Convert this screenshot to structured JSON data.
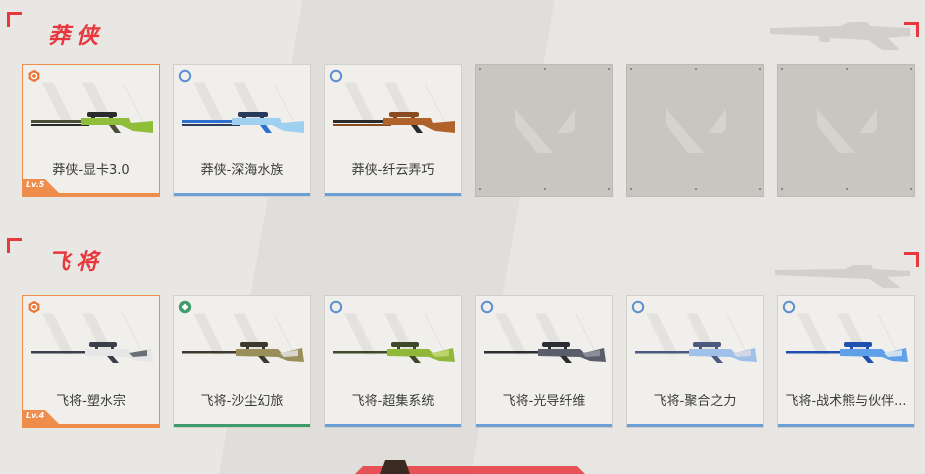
{
  "sections": [
    {
      "title": "莽侠",
      "cards": [
        {
          "label": "莽侠-显卡3.0",
          "rarity": "orange",
          "badge": "premium-hex-icon",
          "level": "Lv.5",
          "gun_colors": [
            "#4a4f3a",
            "#8fbf3a",
            "#2b2b2b"
          ]
        },
        {
          "label": "莽侠-深海水族",
          "rarity": "blue",
          "badge": "ring-icon",
          "gun_colors": [
            "#2f6fcf",
            "#9fd0f0",
            "#2a3a5a"
          ]
        },
        {
          "label": "莽侠-纤云弄巧",
          "rarity": "blue",
          "badge": "ring-icon",
          "gun_colors": [
            "#2b2b2b",
            "#b0622b",
            "#8a4a22"
          ]
        }
      ],
      "empty_slots": 3
    },
    {
      "title": "飞将",
      "cards": [
        {
          "label": "飞将-塑水宗",
          "rarity": "orange",
          "badge": "premium-hex-icon",
          "level": "Lv.4",
          "gun_colors": [
            "#3b3f4a",
            "#e6e6e6",
            "#6a6f7a"
          ]
        },
        {
          "label": "飞将-沙尘幻旅",
          "rarity": "green",
          "badge": "diamond-icon",
          "gun_colors": [
            "#3a3a2f",
            "#9a8f5a",
            "#d8d8d0"
          ]
        },
        {
          "label": "飞将-超集系统",
          "rarity": "blue",
          "badge": "ring-icon",
          "gun_colors": [
            "#3d4a2a",
            "#8fb83a",
            "#bcd46a"
          ]
        },
        {
          "label": "飞将-光导纤维",
          "rarity": "blue",
          "badge": "ring-icon",
          "gun_colors": [
            "#2b2d33",
            "#5a5e6a",
            "#8a8e98"
          ]
        },
        {
          "label": "飞将-聚合之力",
          "rarity": "blue",
          "badge": "ring-icon",
          "gun_colors": [
            "#4a5a80",
            "#9fc0e8",
            "#d0d8e8"
          ]
        },
        {
          "label": "飞将-战术熊与伙伴...",
          "rarity": "blue",
          "badge": "ring-icon",
          "gun_colors": [
            "#1f4fb0",
            "#5fa0e8",
            "#d0e0f0"
          ]
        }
      ],
      "empty_slots": 0
    }
  ],
  "colors": {
    "accent": "#e8383d",
    "rarity_blue": "#6c9fd6",
    "rarity_orange": "#ef8e4c",
    "rarity_green": "#3f9b6c"
  }
}
